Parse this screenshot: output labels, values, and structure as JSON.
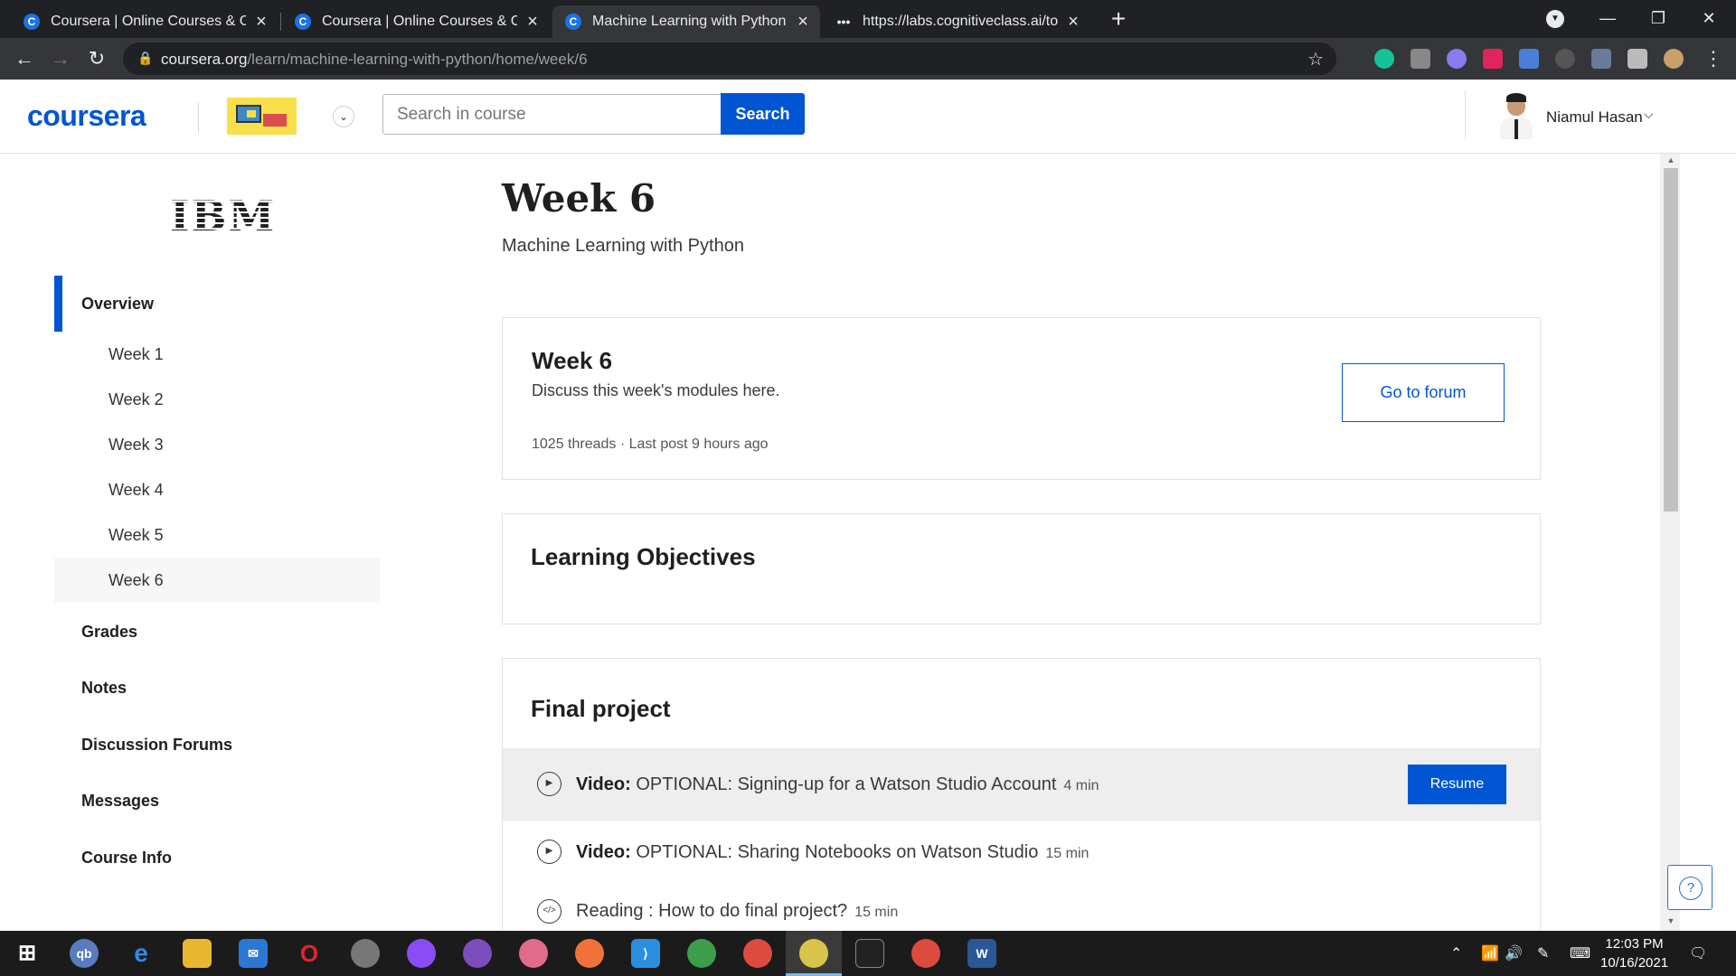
{
  "browser": {
    "tabs": [
      {
        "title": "Coursera | Online Courses & Cred",
        "favicon": "C"
      },
      {
        "title": "Coursera | Online Courses & Cred",
        "favicon": "C"
      },
      {
        "title": "Machine Learning with Python - I",
        "favicon": "C"
      },
      {
        "title": "https://labs.cognitiveclass.ai/tool",
        "favicon": "•••"
      }
    ],
    "url_host": "coursera.org",
    "url_path": "/learn/machine-learning-with-python/home/week/6"
  },
  "header": {
    "logo": "coursera",
    "search_placeholder": "Search in course",
    "search_label": "Search",
    "user_name": "Niamul Hasan"
  },
  "sidebar": {
    "brand": "IBM",
    "overview": "Overview",
    "weeks": [
      "Week 1",
      "Week 2",
      "Week 3",
      "Week 4",
      "Week 5",
      "Week 6"
    ],
    "links": [
      "Grades",
      "Notes",
      "Discussion Forums",
      "Messages",
      "Course Info"
    ]
  },
  "main": {
    "title": "Week 6",
    "subtitle": "Machine Learning with Python",
    "forum": {
      "title": "Week 6",
      "description": "Discuss this week's modules here.",
      "meta": "1025 threads · Last post 9 hours ago",
      "button": "Go to forum"
    },
    "objectives_title": "Learning Objectives",
    "final_project": {
      "title": "Final project",
      "items": [
        {
          "type": "Video:",
          "title": "OPTIONAL: Signing-up for a Watson Studio Account",
          "duration": "4 min",
          "action": "Resume"
        },
        {
          "type": "Video:",
          "title": "OPTIONAL: Sharing Notebooks on Watson Studio",
          "duration": "15 min"
        },
        {
          "type": "",
          "title": "Reading : How to do final project?",
          "duration": "15 min"
        }
      ]
    }
  },
  "taskbar": {
    "time": "12:03 PM",
    "date": "10/16/2021"
  },
  "colors": {
    "brand": "#0056d2",
    "chrome_dark": "#202124",
    "chrome_toolbar": "#35363a"
  }
}
